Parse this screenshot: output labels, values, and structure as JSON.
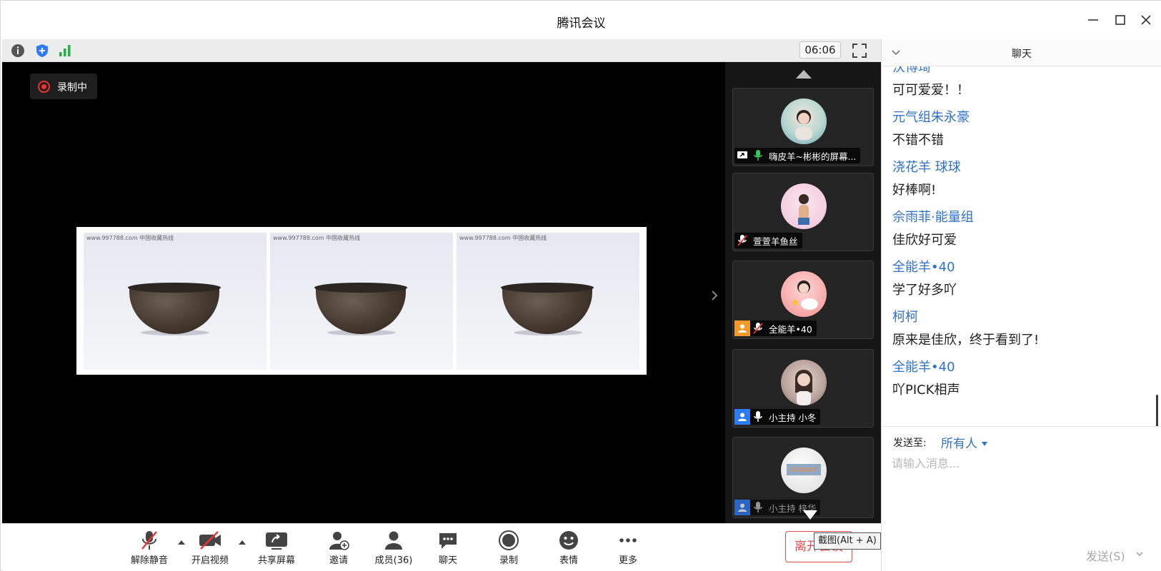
{
  "window": {
    "title": "腾讯会议"
  },
  "infobar": {
    "timer": "06:06"
  },
  "stage": {
    "recording_label": "录制中",
    "watermark": "www.997788.com 中国收藏热线"
  },
  "participants": [
    {
      "name": "嗨皮羊~彬彬的屏幕...",
      "mic": "on",
      "badge": "share"
    },
    {
      "name": "萱萱羊鱼丝",
      "mic": "muted",
      "badge": "none"
    },
    {
      "name": "全能羊•40",
      "mic": "muted",
      "badge": "host"
    },
    {
      "name": "小主持 小冬",
      "mic": "off",
      "badge": "user"
    },
    {
      "name": "小主持 梓华",
      "mic": "off",
      "badge": "user",
      "avatar_text": "winner"
    }
  ],
  "toolbar": {
    "unmute": "解除静音",
    "start_video": "开启视频",
    "share_screen": "共享屏幕",
    "invite": "邀请",
    "members": "成员(36)",
    "chat": "聊天",
    "record": "录制",
    "reactions": "表情",
    "more": "更多",
    "leave": "离开会议",
    "tooltip": "截图(Alt + A)"
  },
  "chat": {
    "title": "聊天",
    "messages": [
      {
        "sender": "沃博琦",
        "text": "可可爱爱！！"
      },
      {
        "sender": "元气组朱永豪",
        "text": "不错不错"
      },
      {
        "sender": "浇花羊 球球",
        "text": "好棒啊!"
      },
      {
        "sender": "佘雨菲·能量组",
        "text": "佳欣好可爱"
      },
      {
        "sender": "全能羊•40",
        "text": "学了好多吖"
      },
      {
        "sender": "柯柯",
        "text": "原来是佳欣，终于看到了!"
      },
      {
        "sender": "全能羊•40",
        "text": "吖PICK相声"
      }
    ],
    "send_to_label": "发送至:",
    "recipient": "所有人",
    "input_placeholder": "请输入消息...",
    "send_label": "发送(S)"
  },
  "colors": {
    "accent": "#2f72c8",
    "leave": "#e64b4b",
    "recording": "#e33333",
    "mic_on": "#35c759"
  }
}
